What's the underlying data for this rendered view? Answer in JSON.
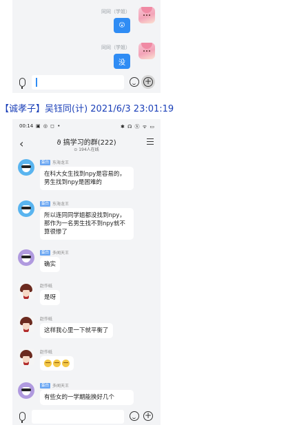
{
  "top_chat": {
    "messages": [
      {
        "sender": "同同（学姐）",
        "text": "😮",
        "icon": "emoji-icon"
      },
      {
        "sender": "同同（学姐）",
        "text": "没"
      }
    ],
    "input": {
      "value": ""
    }
  },
  "caption": "【诚孝子】吴钰同(计) 2021/6/3 23:01:19",
  "bottom_chat": {
    "status": {
      "time": "00:14",
      "left_icons": "▣ ◎ ◻ •",
      "right_icons": "✱ ☊ ⓗ ᯤ ▭"
    },
    "header": {
      "back": "‹",
      "group_icon": "ϑ",
      "title": "搞学习的群(222)",
      "online": "⊙ 194人在线"
    },
    "messages": [
      {
        "role": "蛋白",
        "name": "东海龙王",
        "text": "在科大女生找到npy是容易的，男生找到npy是困难的",
        "avatar": "blue"
      },
      {
        "role": "蛋白",
        "name": "东海龙王",
        "text": "所以连同同学姐都没找到npy，那作为一名男生找不到npy就不算很惨了",
        "avatar": "blue"
      },
      {
        "role": "蛋白",
        "name": "多闻天王",
        "text": "确实",
        "avatar": "purple"
      },
      {
        "role": "",
        "name": "赵作砥",
        "text": "是呀",
        "avatar": "anime"
      },
      {
        "role": "",
        "name": "赵作砥",
        "text": "这样我心里一下就平衡了",
        "avatar": "anime"
      },
      {
        "role": "",
        "name": "赵作砥",
        "text": "",
        "emojis": 3,
        "avatar": "anime"
      },
      {
        "role": "蛋白",
        "name": "多闻天王",
        "text": "有些女的一学期能换好几个",
        "avatar": "purple"
      }
    ],
    "input": {
      "value": ""
    }
  }
}
